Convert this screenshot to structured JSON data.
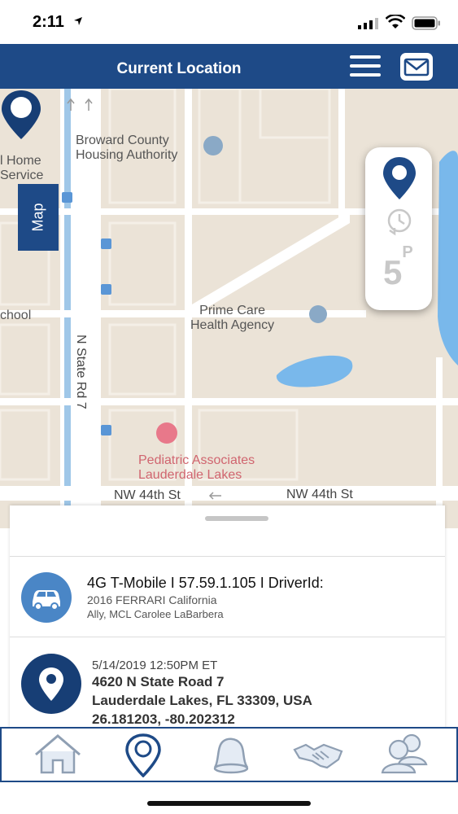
{
  "status_bar": {
    "time": "2:11"
  },
  "header": {
    "title": "Current Location",
    "menu_icon": "hamburger-menu-icon",
    "mail_icon": "mail-icon"
  },
  "map": {
    "tab_label": "Map",
    "labels": {
      "housing": "Broward County\nHousing Authority",
      "home_service": "l Home\nService",
      "school": "chool",
      "state_rd": "N State Rd 7",
      "prime_care": "Prime Care\nHealth Agency",
      "pediatric": "Pediatric Associates\nLauderdale Lakes",
      "nw44_left": "NW 44th St",
      "nw44_right": "NW 44th St"
    },
    "side_panel": {
      "parking_value": "5",
      "parking_suffix": "P"
    }
  },
  "sheet": {
    "vehicle": {
      "title": "4G T-Mobile I 57.59.1.105 I DriverId:",
      "model": "2016 FERRARI California",
      "owner": "Ally, MCL Carolee LaBarbera"
    },
    "location": {
      "timestamp": "5/14/2019 12:50PM ET",
      "address_line1": "4620 N State Road 7",
      "address_line2": "Lauderdale Lakes, FL 33309, USA",
      "coordinates": "26.181203, -80.202312"
    }
  },
  "tabbar": {
    "tabs": [
      "home-icon",
      "location-pin-icon",
      "bell-icon",
      "handshake-icon",
      "users-icon"
    ]
  },
  "colors": {
    "brand": "#1e4a87",
    "map_bg": "#ebe3d7",
    "water": "#79b8eb"
  }
}
